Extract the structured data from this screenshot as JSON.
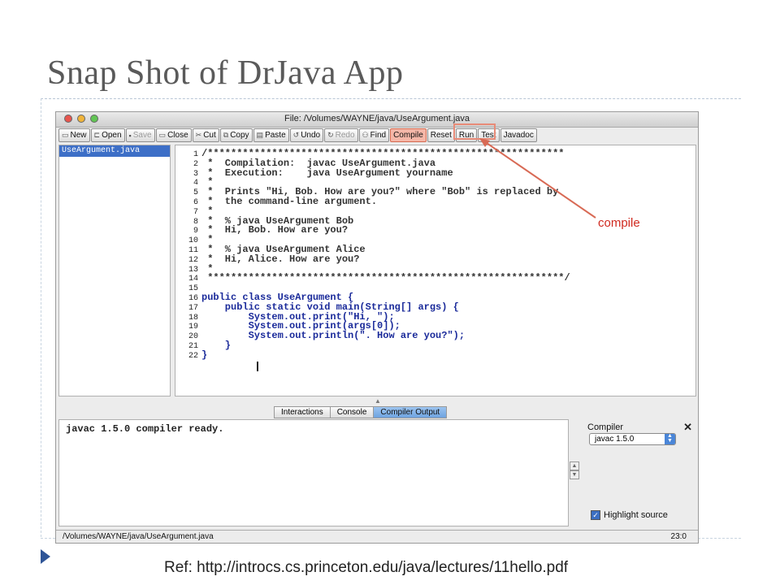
{
  "slide": {
    "title": "Snap Shot of DrJava App",
    "reference": "Ref: http://introcs.cs.princeton.edu/java/lectures/11hello.pdf"
  },
  "window": {
    "title": "File: /Volumes/WAYNE/java/UseArgument.java"
  },
  "toolbar": {
    "buttons": [
      {
        "label": "New",
        "icon": "new-file-icon",
        "enabled": true
      },
      {
        "label": "Open",
        "icon": "open-folder-icon",
        "enabled": true
      },
      {
        "label": "Save",
        "icon": "save-icon",
        "enabled": false
      },
      {
        "label": "Close",
        "icon": "close-file-icon",
        "enabled": true
      },
      {
        "label": "Cut",
        "icon": "scissors-icon",
        "enabled": true
      },
      {
        "label": "Copy",
        "icon": "copy-icon",
        "enabled": true
      },
      {
        "label": "Paste",
        "icon": "paste-icon",
        "enabled": true
      },
      {
        "label": "Undo",
        "icon": "undo-icon",
        "enabled": true
      },
      {
        "label": "Redo",
        "icon": "redo-icon",
        "enabled": false
      },
      {
        "label": "Find",
        "icon": "binoculars-icon",
        "enabled": true
      },
      {
        "label": "Compile",
        "icon": "",
        "enabled": true
      },
      {
        "label": "Reset",
        "icon": "",
        "enabled": true
      },
      {
        "label": "Run",
        "icon": "",
        "enabled": true
      },
      {
        "label": "Test",
        "icon": "",
        "enabled": true
      },
      {
        "label": "Javadoc",
        "icon": "",
        "enabled": true
      }
    ]
  },
  "files": {
    "items": [
      "UseArgument.java"
    ]
  },
  "editor": {
    "lines": [
      {
        "n": "1",
        "text": "/*************************************************************"
      },
      {
        "n": "2",
        "text": " *  Compilation:  javac UseArgument.java"
      },
      {
        "n": "3",
        "text": " *  Execution:    java UseArgument yourname"
      },
      {
        "n": "4",
        "text": " *"
      },
      {
        "n": "5",
        "text": " *  Prints \"Hi, Bob. How are you?\" where \"Bob\" is replaced by"
      },
      {
        "n": "6",
        "text": " *  the command-line argument."
      },
      {
        "n": "7",
        "text": " *"
      },
      {
        "n": "8",
        "text": " *  % java UseArgument Bob"
      },
      {
        "n": "9",
        "text": " *  Hi, Bob. How are you?"
      },
      {
        "n": "10",
        "text": " *"
      },
      {
        "n": "11",
        "text": " *  % java UseArgument Alice"
      },
      {
        "n": "12",
        "text": " *  Hi, Alice. How are you?"
      },
      {
        "n": "13",
        "text": " *"
      },
      {
        "n": "14",
        "text": " *************************************************************/"
      },
      {
        "n": "15",
        "text": ""
      },
      {
        "n": "16",
        "text": "public class UseArgument {"
      },
      {
        "n": "17",
        "text": "    public static void main(String[] args) {"
      },
      {
        "n": "18",
        "text": "        System.out.print(\"Hi, \");"
      },
      {
        "n": "19",
        "text": "        System.out.print(args[0]);"
      },
      {
        "n": "20",
        "text": "        System.out.println(\". How are you?\");"
      },
      {
        "n": "21",
        "text": "    }"
      },
      {
        "n": "22",
        "text": "}"
      }
    ]
  },
  "annotation": {
    "label": "compile",
    "color": "#d02a20"
  },
  "bottom_tabs": {
    "items": [
      "Interactions",
      "Console",
      "Compiler Output"
    ],
    "active": "Compiler Output"
  },
  "output": {
    "text": "javac 1.5.0 compiler ready."
  },
  "compiler_panel": {
    "label": "Compiler",
    "selected": "javac 1.5.0",
    "highlight_label": "Highlight source",
    "highlight_checked": true
  },
  "status": {
    "path": "/Volumes/WAYNE/java/UseArgument.java",
    "position": "23:0"
  }
}
